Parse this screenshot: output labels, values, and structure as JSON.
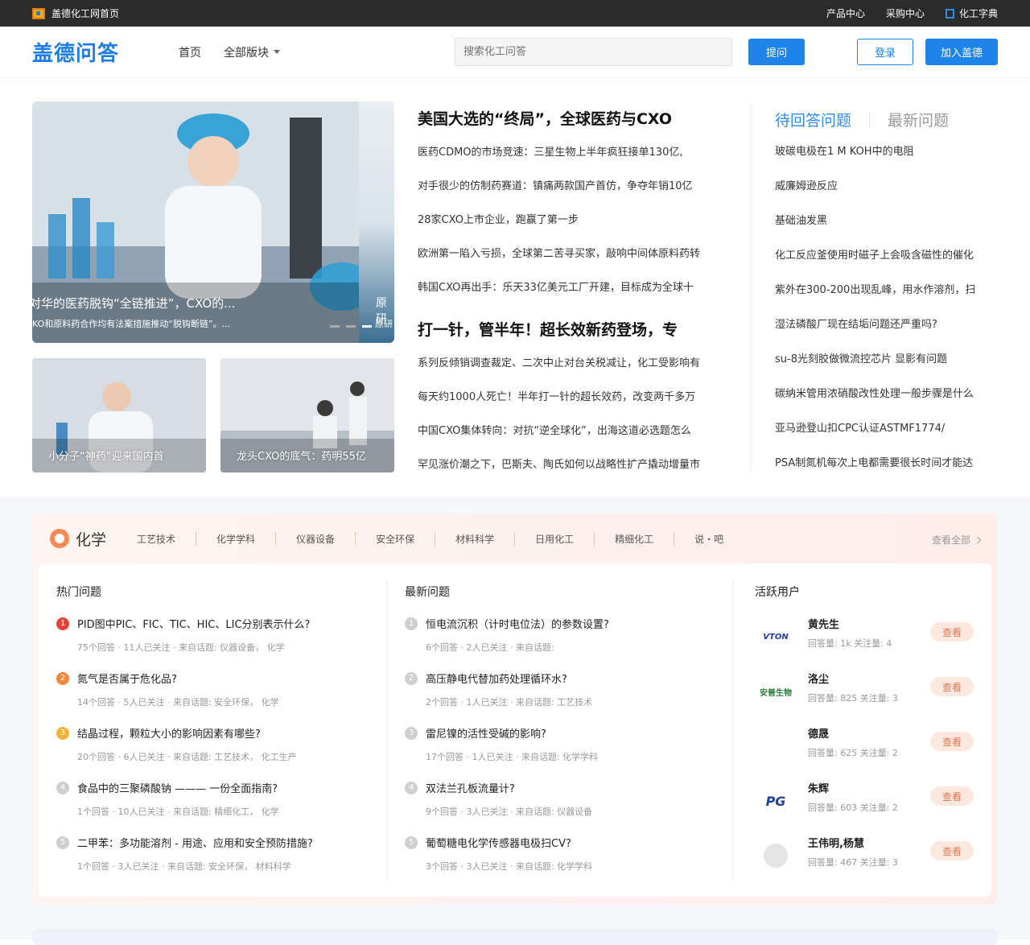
{
  "topbar": {
    "home_label": "盖德化工网首页",
    "links": [
      "产品中心",
      "采购中心",
      "化工字典"
    ]
  },
  "header": {
    "logo": "盖德问答",
    "nav": [
      "首页",
      "全部版块"
    ],
    "search_placeholder": "搜索化工问答",
    "ask": "提问",
    "login": "登录",
    "join": "加入盖德"
  },
  "hero": {
    "banner_caption": "对华的医药脱钩“全链推进”，CXO的...",
    "banner_sub": "KO和原料药合作均有法案措施推动“脱钩断链”。...",
    "side_caption": "原研",
    "side_sub": "原研",
    "thumbs": [
      "小分子“神药”迎来国内首",
      "龙头CXO的底气：药明55亿"
    ]
  },
  "news": {
    "headline1": "美国大选的“终局”，全球医药与CXO",
    "items1": [
      "医药CDMO的市场竞速：三星生物上半年疯狂接单130亿,",
      "对手很少的仿制药赛道：镇痛两款国产首仿，争夺年销10亿",
      "28家CXO上市企业，跑赢了第一步",
      "欧洲第一陷入亏损，全球第二苦寻买家，敲响中间体原料药转",
      "韩国CXO再出手：乐天33亿美元工厂开建，目标成为全球十"
    ],
    "headline2": "打一针，管半年！超长效新药登场，专",
    "items2": [
      "系列反倾销调查裁定、二次中止对台关税减让，化工受影响有",
      "每天约1000人死亡！半年打一针的超长效药，改变两千多万",
      "中国CXO集体转向：对抗“逆全球化”，出海这道必选题怎么",
      "罕见涨价潮之下，巴斯夫、陶氏如何以战略性扩产撬动增量市"
    ]
  },
  "qpanel": {
    "tab_active": "待回答问题",
    "tab_inactive": "最新问题",
    "items": [
      "玻碳电极在1 M KOH中的电阻",
      "威廉姆逊反应",
      "基础油发黑",
      "化工反应釜使用时磁子上会吸含磁性的催化",
      "紫外在300-200出现乱峰，用水作溶剂，扫",
      "湿法磷酸厂现在结垢问题还严重吗?",
      "su-8光刻胶做微流控芯片 显影有问题",
      "碳纳米管用浓硝酸改性处理一般步骤是什么",
      "亚马逊登山扣CPC认证ASTMF1774/",
      "PSA制氮机每次上电都需要很长时间才能达"
    ]
  },
  "section": {
    "title": "化学",
    "categories": [
      "工艺技术",
      "化学学科",
      "仪器设备",
      "安全环保",
      "材料科学",
      "日用化工",
      "精细化工",
      "说・吧"
    ],
    "view_all": "查看全部",
    "hot_title": "热门问题",
    "new_title": "最新问题",
    "users_title": "活跃用户",
    "hot": [
      {
        "rank": "1",
        "title": "PID图中PIC、FIC、TIC、HIC、LIC分别表示什么?",
        "meta": "75个回答 · 11人已关注 · 来自话题:   仪器设备，  化学"
      },
      {
        "rank": "2",
        "title": "氮气是否属于危化品?",
        "meta": "14个回答 · 5人已关注 · 来自话题:   安全环保，  化学"
      },
      {
        "rank": "3",
        "title": "结晶过程，颗粒大小的影响因素有哪些?",
        "meta": "20个回答 · 6人已关注 · 来自话题:   工艺技术，  化工生产"
      },
      {
        "rank": "4",
        "title": "食品中的三聚磷酸钠 ——— 一份全面指南?",
        "meta": "1个回答 · 10人已关注 · 来自话题:   精细化工，  化学"
      },
      {
        "rank": "5",
        "title": "二甲苯：多功能溶剂 - 用途、应用和安全预防措施?",
        "meta": "1个回答 · 3人已关注 · 来自话题:   安全环保，  材料科学"
      }
    ],
    "latest": [
      {
        "rank": "1",
        "title": "恒电流沉积（计时电位法）的参数设置?",
        "meta": "6个回答 · 2人已关注 · 来自话题:"
      },
      {
        "rank": "2",
        "title": "高压静电代替加药处理循环水?",
        "meta": "2个回答 · 1人已关注 · 来自话题:   工艺技术"
      },
      {
        "rank": "3",
        "title": "雷尼镍的活性受碱的影响?",
        "meta": "17个回答 · 1人已关注 · 来自话题:   化学学科"
      },
      {
        "rank": "4",
        "title": "双法兰孔板流量计?",
        "meta": "9个回答 · 3人已关注 · 来自话题:   仪器设备"
      },
      {
        "rank": "5",
        "title": "葡萄糖电化学传感器电极扫CV?",
        "meta": "3个回答 · 3人已关注 · 来自话题:   化学学科"
      }
    ],
    "users": [
      {
        "name": "黄先生",
        "stat": "回答量: 1k  关注量: 4",
        "logo": "VTON"
      },
      {
        "name": "洛尘",
        "stat": "回答量: 825  关注量: 3",
        "logo": "安普生物"
      },
      {
        "name": "德晟",
        "stat": "回答量: 625  关注量: 2",
        "logo": ""
      },
      {
        "name": "朱辉",
        "stat": "回答量: 603  关注量: 2",
        "logo": "PG"
      },
      {
        "name": "王伟明,杨慧",
        "stat": "回答量: 467  关注量: 3",
        "logo": ""
      }
    ],
    "view_label": "查看"
  }
}
